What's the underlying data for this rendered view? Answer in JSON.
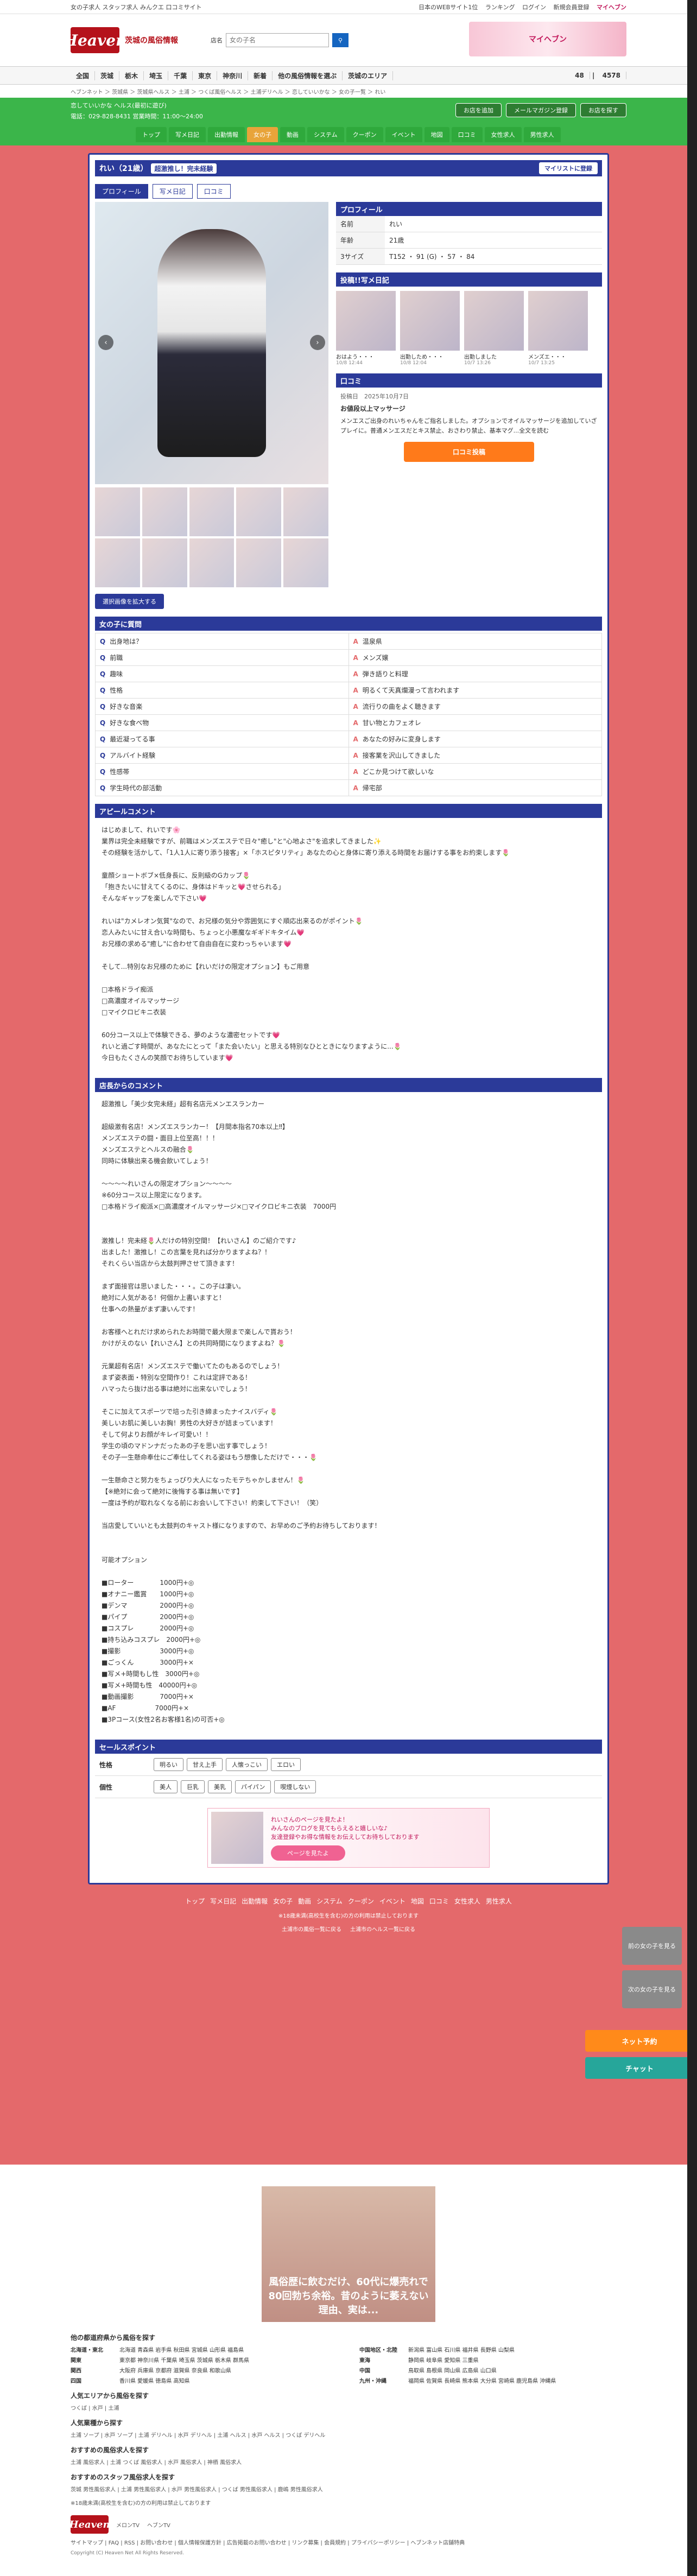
{
  "topbar": {
    "tagline": "女の子求人 スタッフ求人 みんクエ 口コミサイト",
    "links": [
      "日本のWEBサイト1位",
      "ランキング",
      "ログイン",
      "新規会員登録",
      "マイヘブン"
    ]
  },
  "header": {
    "logo": "Heaven",
    "region": "茨城の風俗情報",
    "search_label": "店名",
    "search_placeholder": "女の子名",
    "banner": "マイヘブン"
  },
  "nav": {
    "items": [
      "全国",
      "茨城",
      "栃木",
      "埼玉",
      "千葉",
      "東京",
      "神奈川",
      "新着",
      "他の風俗情報を選ぶ",
      "茨城のエリア"
    ],
    "count1": "48",
    "count2": "4578"
  },
  "breadcrumb": "ヘブンネット ＞ 茨城県 ＞ 茨城県ヘルス ＞ 土浦 ＞ つくば風俗ヘルス ＞ 土浦デリヘル ＞ 恋していいかな ＞ 女の子一覧 ＞ れい",
  "shop": {
    "name": "恋していいかな ヘルス(最初に遊び)",
    "info": "電話：029-828-8431 営業時間：11:00〜24:00",
    "buttons": [
      "お店を追加",
      "メールマガジン登録",
      "お店を探す"
    ],
    "tabs": [
      "トップ",
      "写メ日記",
      "出勤情報",
      "女の子",
      "動画",
      "システム",
      "クーポン",
      "イベント",
      "地図",
      "口コミ",
      "女性求人",
      "男性求人"
    ],
    "active_tab": "女の子"
  },
  "girl": {
    "name": "れい（21歳）",
    "catch": "超激推し！完未経験",
    "mylist": "マイリストに登録",
    "subtabs": [
      "プロフィール",
      "写メ日記",
      "口コミ"
    ],
    "choose_button": "選択画像を拡大する"
  },
  "profile": {
    "title": "プロフィール",
    "rows": [
      {
        "k": "名前",
        "v": "れい"
      },
      {
        "k": "年齢",
        "v": "21歳"
      },
      {
        "k": "3サイズ",
        "v": "T152 ・ 91 (G) ・ 57 ・ 84"
      }
    ]
  },
  "diary": {
    "title": "投稿!!写メ日記",
    "items": [
      {
        "t": "おはよう・・・",
        "d": "10/8 12:44"
      },
      {
        "t": "出勤しため・・・",
        "d": "10/8 12:04"
      },
      {
        "t": "出勤しました",
        "d": "10/7 13:26"
      },
      {
        "t": "メンズエ・・・",
        "d": "10/7 13:25"
      }
    ]
  },
  "review": {
    "title": "口コミ",
    "date": "投稿日　2025年10月7日",
    "heading": "お値段以上マッサージ",
    "body": "メンエスご出身のれいちゃんをご指名しました。オプションでオイルマッサージを追加していざプレイに。普通メンエスだとキス禁止、おさわり禁止、基本マグ...全文を読む",
    "button": "口コミ投稿"
  },
  "qa": {
    "title": "女の子に質問",
    "items": [
      {
        "q": "出身地は？",
        "a": "温泉県"
      },
      {
        "q": "前職",
        "a": "メンズ嬢"
      },
      {
        "q": "趣味",
        "a": "弾き語りと料理"
      },
      {
        "q": "性格",
        "a": "明るくて天真爛漫って言われます"
      },
      {
        "q": "好きな音楽",
        "a": "流行りの曲をよく聴きます"
      },
      {
        "q": "好きな食べ物",
        "a": "甘い物とカフェオレ"
      },
      {
        "q": "最近凝ってる事",
        "a": "あなたの好みに変身します"
      },
      {
        "q": "アルバイト経験",
        "a": "接客業を沢山してきました"
      },
      {
        "q": "性感帯",
        "a": "どこか見つけて欲しいな"
      },
      {
        "q": "学生時代の部活動",
        "a": "帰宅部"
      }
    ]
  },
  "appeal": {
    "title": "アピールコメント",
    "body": "はじめまして、れいです🌸\n業界は完全未経験ですが、前職はメンズエステで日々\"癒し\"と\"心地よさ\"を追求してきました✨\nその経験を活かして、「1人1人に寄り添う接客」×「ホスピタリティ」あなたの心と身体に寄り添える時間をお届けする事をお約束します🌷\n\n童顔ショートボブ×低身長に、反則級のGカップ🌷\n「抱きたいに甘えてくるのに、身体はドキッと💗させられる」\nそんなギャップを楽しんで下さい💗\n\nれいは\"カメレオン気質\"なので、お兄様の気分や雰囲気にすぐ順応出来るのがポイント🌷\n恋人みたいに甘え合いな時間も、ちょっと小悪魔なギギドキタイム💗\nお兄様の求める\"癒し\"に合わせて自由自在に変わっちゃいます💗\n\nそして...特別なお兄様のために【れいだけの限定オプション】もご用意\n\n□本格ドライ痴派\n□高濃度オイルマッサージ\n□マイクロビキニ衣装\n\n60分コース以上で体験できる、夢のような濃密セットです💗\nれいと過ごす時間が、あなたにとって「また会いたい」と思える特別なひとときになりますように...🌷\n今日もたくさんの笑顔でお待ちしています💗"
  },
  "shop_comment": {
    "title": "店長からのコメント",
    "body": "超激推し「美少女完未経」超有名店元メンエスランカー\n\n超級激有名店！メンズエスランカー！【月間本指名70本以上‼】\nメンズエステの闘・面目上位至高！！！\nメンズエステとヘルスの融合🌷\n同時に体験出来る機会飲いてしょう！\n\n〜〜〜〜れいさんの限定オプション〜〜〜〜\n※60分コース以上限定になります。\n□本格ドライ痴派×□高濃度オイルマッサージ×□マイクロビキニ衣装　7000円\n\n\n激推し！完未経🌷人だけの特別空間！【れいさん】のご紹介です♪\n出ました！激推し！この言葉を見れば分かりますよね？！\nそれくらい当店から太鼓判押させて頂きます！\n\nまず面接官は思いました・・・。この子は凄い。\n絶対に人気がある！何個か上書いますと！\n仕事への熱量がまず凄いんです！\n\nお客様へとれだけ求められたお時間で最大限まで楽しんで貰おう！\nかけがえのない【れいさん】との共同時間になりますよね？🌷\n\n元業超有名店！メンズエステで働いてたのもあるのでしょう！\nまず姿表面・特別な空間作り！これは定評である！\nハマったら抜け出る事は絶対に出来ないでしょう！\n\nそこに加えてスポーツで培った引き締まったナイスバディ🌷\n美しいお肌に美しいお胸！男性の大好きが詰まっています！\nそして何よりお顔がキレイ可愛い！！\n学生の頃のマドンナだったあの子を思い出す事でしょう！\nその子一生懸命奉仕にご奉仕してくれる姿はもう想像しただけで・・・🌷\n\n一生懸命さと努力をちょっぴり大人になったモテちゃかしません！🌷\n【※絶対に会って絶対に後悔する事は無いです】\n一度は予約が取れなくなる前にお会いして下さい！約束して下さい！（笑）\n\n当店愛していいとも太鼓判のキャスト様になりますので、お早めのご予約お待ちしております！\n\n\n可能オプション\n\n■ローター　　　　1000円+◎\n■オナニー鑑賞　　1000円+◎\n■デンマ　　　　　2000円+◎\n■パイプ　　　　　2000円+◎\n■コスプレ　　　　2000円+◎\n■持ち込みコスプレ　2000円+◎\n■撮影　　　　　　3000円+◎\n■ごっくん　　　　3000円+×\n■写メ+時間もし性　3000円+◎\n■写メ+時間も性　40000円+◎\n■動画撮影　　　　7000円+×\n■AF　　　　　　7000円+×\n■3Pコース(女性2名お客様1名)の可否+◎"
  },
  "sales": {
    "title": "セールスポイント",
    "rows": [
      {
        "label": "性格",
        "tags": [
          "明るい",
          "甘え上手",
          "人懐っこい",
          "エロい"
        ]
      },
      {
        "label": "個性",
        "tags": [
          "美人",
          "巨乳",
          "美乳",
          "パイパン",
          "喫煙しない"
        ]
      }
    ]
  },
  "promo": {
    "text": "れいさんのページを見たよ！\nみんなのブログを見てもらえると嬉しいな♪\n友達登録やお得な情報をお伝えしてお待ちしております",
    "button": "ページを見たよ"
  },
  "footnav": {
    "items": [
      "トップ",
      "写メ日記",
      "出勤情報",
      "女の子",
      "動画",
      "システム",
      "クーポン",
      "イベント",
      "地図",
      "口コミ",
      "女性求人",
      "男性求人"
    ],
    "note": "※18歳未満(高校生を含む)の方の利用は禁止しております",
    "links": [
      "土浦市の風俗一覧に戻る",
      "土浦市のヘルス一覧に戻る"
    ]
  },
  "side": {
    "net_reserve": "ネット予約",
    "chat": "チャット",
    "prev": "前の女の子を見る",
    "next": "次の女の子を見る"
  },
  "footer": {
    "ad_text": "風俗歴に飲むだけ、60代に爆売れで80回勃ち余裕。昔のように萎えない理由、実は...",
    "areas_title": "他の都道府県から風俗を探す",
    "areas": [
      {
        "name": "北海道・東北",
        "list": "北海道 青森県 岩手県 秋田県 宮城県 山形県 福島県"
      },
      {
        "name": "中国地区・北陸",
        "list": "新潟県 富山県 石川県 福井県 長野県 山梨県"
      },
      {
        "name": "関東",
        "list": "東京都 神奈川県 千葉県 埼玉県 茨城県 栃木県 群馬県"
      },
      {
        "name": "東海",
        "list": "静岡県 岐阜県 愛知県 三重県"
      },
      {
        "name": "関西",
        "list": "大阪府 兵庫県 京都府 滋賀県 奈良県 和歌山県"
      },
      {
        "name": "中国",
        "list": "鳥取県 島根県 岡山県 広島県 山口県"
      },
      {
        "name": "四国",
        "list": "香川県 愛媛県 徳島県 高知県"
      },
      {
        "name": "九州・沖縄",
        "list": "福岡県 佐賀県 長崎県 熊本県 大分県 宮崎県 鹿児島県 沖縄県"
      }
    ],
    "popular_area_title": "人気エリアから風俗を探す",
    "popular_area": "つくば | 水戸 | 土浦",
    "popular_type_title": "人気業種から探す",
    "popular_type": "土浦 ソープ | 水戸 ソープ | 土浦 デリヘル | 水戸 デリヘル | 土浦 ヘルス | 水戸 ヘルス | つくば デリヘル",
    "rec_title": "おすすめの風俗求人を探す",
    "rec": "土浦 風俗求人 | 土浦 つくば 風俗求人 | 水戸 風俗求人 | 神栖 風俗求人",
    "staff_title": "おすすめのスタッフ風俗求人を探す",
    "staff": "茨城 男性風俗求人 | 土浦 男性風俗求人 | 水戸 男性風俗求人 | つくば 男性風俗求人 | 鹿嶋 男性風俗求人",
    "age_note": "※18歳未満(高校生を含む)の方の利用は禁止しております",
    "logo": "Heaven",
    "sns": [
      "メロンTV",
      "ヘブンTV"
    ],
    "links": "サイトマップ | FAQ | RSS | お問い合わせ | 個人情報保護方針 | 広告掲載のお問い合わせ | リンク募集 | 会員規約 | プライバシーポリシー | ヘブンネット店舗特典",
    "copyright": "Copyright (C) Heaven Net All Rights Reserved."
  }
}
